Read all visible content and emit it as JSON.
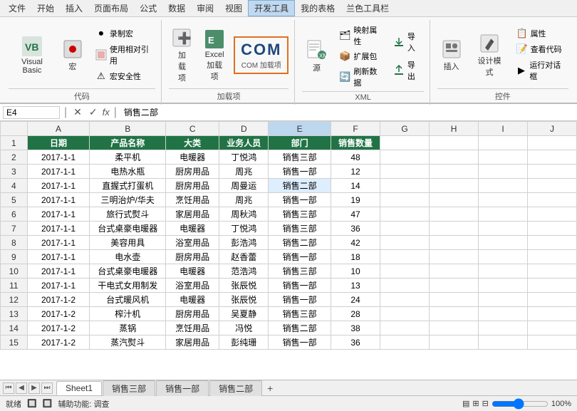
{
  "menu": {
    "items": [
      "文件",
      "开始",
      "插入",
      "页面布局",
      "公式",
      "数据",
      "审阅",
      "视图",
      "开发工具",
      "我的表格",
      "兰色工具栏"
    ],
    "active": "开发工具"
  },
  "ribbon": {
    "groups": [
      {
        "label": "代码",
        "buttons": [
          {
            "id": "visual-basic",
            "icon": "📋",
            "label": "Visual Basic"
          },
          {
            "id": "macro",
            "icon": "⏺",
            "label": "宏"
          }
        ],
        "small_buttons": [
          {
            "id": "record-macro",
            "icon": "⏺",
            "label": "录制宏"
          },
          {
            "id": "use-relative-ref",
            "icon": "📎",
            "label": "使用相对引用"
          },
          {
            "id": "macro-security",
            "icon": "⚠",
            "label": "宏安全性"
          }
        ]
      },
      {
        "label": "加载项",
        "buttons": [
          {
            "id": "add-item",
            "icon": "➕",
            "label": "加载项"
          },
          {
            "id": "excel-addon",
            "icon": "📊",
            "label": "Excel 加载项"
          },
          {
            "id": "com-addon",
            "icon": "COM",
            "label": "COM 加载项"
          }
        ]
      },
      {
        "label": "XML",
        "buttons": [
          {
            "id": "source",
            "icon": "📄",
            "label": "源"
          }
        ],
        "small_buttons": [
          {
            "id": "map-prop",
            "icon": "🗂",
            "label": "映射属性"
          },
          {
            "id": "expand-pack",
            "icon": "📦",
            "label": "扩展包"
          },
          {
            "id": "refresh-data",
            "icon": "🔄",
            "label": "刷新数据"
          },
          {
            "id": "import",
            "icon": "📥",
            "label": "导入"
          },
          {
            "id": "export",
            "icon": "📤",
            "label": "导出"
          }
        ]
      },
      {
        "label": "控件",
        "buttons": [
          {
            "id": "insert-ctrl",
            "icon": "🔲",
            "label": "插入"
          },
          {
            "id": "design-mode",
            "icon": "✏",
            "label": "设计模式"
          }
        ],
        "small_buttons": [
          {
            "id": "properties",
            "icon": "📋",
            "label": "属性"
          },
          {
            "id": "view-code",
            "icon": "📝",
            "label": "查看代码"
          },
          {
            "id": "run-dialog",
            "icon": "▶",
            "label": "运行对话框"
          }
        ]
      }
    ]
  },
  "formula_bar": {
    "name_box": "E4",
    "formula_content": "销售二部",
    "fx": "fx"
  },
  "columns": [
    "A",
    "B",
    "C",
    "D",
    "E",
    "F",
    "G",
    "H",
    "I",
    "J"
  ],
  "headers": [
    "日期",
    "产品名称",
    "大类",
    "业务人员",
    "部门",
    "销售数量"
  ],
  "rows": [
    {
      "num": 2,
      "a": "2017-1-1",
      "b": "柔平机",
      "c": "电暖器",
      "d": "丁悦鸿",
      "e": "销售三部",
      "f": "48"
    },
    {
      "num": 3,
      "a": "2017-1-1",
      "b": "电热水瓶",
      "c": "厨房用品",
      "d": "周兆",
      "e": "销售一部",
      "f": "12"
    },
    {
      "num": 4,
      "a": "2017-1-1",
      "b": "直握式打蛋机",
      "c": "厨房用品",
      "d": "周曼运",
      "e": "销售二部",
      "f": "14",
      "selected": true
    },
    {
      "num": 5,
      "a": "2017-1-1",
      "b": "三明治炉/华夫",
      "c": "烹饪用品",
      "d": "周兆",
      "e": "销售一部",
      "f": "19"
    },
    {
      "num": 6,
      "a": "2017-1-1",
      "b": "旅行式熨斗",
      "c": "家居用品",
      "d": "周秋鸿",
      "e": "销售三部",
      "f": "47"
    },
    {
      "num": 7,
      "a": "2017-1-1",
      "b": "台式桌豪电暖器",
      "c": "电暖器",
      "d": "丁悦鸿",
      "e": "销售三部",
      "f": "36"
    },
    {
      "num": 8,
      "a": "2017-1-1",
      "b": "美容用具",
      "c": "浴室用品",
      "d": "彭浩鸿",
      "e": "销售二部",
      "f": "42"
    },
    {
      "num": 9,
      "a": "2017-1-1",
      "b": "电水壶",
      "c": "厨房用品",
      "d": "赵香蕾",
      "e": "销售一部",
      "f": "18"
    },
    {
      "num": 10,
      "a": "2017-1-1",
      "b": "台式桌豪电暖器",
      "c": "电暖器",
      "d": "范浩鸿",
      "e": "销售三部",
      "f": "10"
    },
    {
      "num": 11,
      "a": "2017-1-1",
      "b": "干电式女用制发",
      "c": "浴室用品",
      "d": "张辰悦",
      "e": "销售一部",
      "f": "13"
    },
    {
      "num": 12,
      "a": "2017-1-2",
      "b": "台式暖风机",
      "c": "电暖器",
      "d": "张辰悦",
      "e": "销售一部",
      "f": "24"
    },
    {
      "num": 13,
      "a": "2017-1-2",
      "b": "榨汁机",
      "c": "厨房用品",
      "d": "吴夏静",
      "e": "销售三部",
      "f": "28"
    },
    {
      "num": 14,
      "a": "2017-1-2",
      "b": "蒸锅",
      "c": "烹饪用品",
      "d": "冯悦",
      "e": "销售二部",
      "f": "38"
    },
    {
      "num": 15,
      "a": "2017-1-2",
      "b": "蒸汽熨斗",
      "c": "家居用品",
      "d": "彭纯珊",
      "e": "销售一部",
      "f": "36"
    }
  ],
  "sheet_tabs": [
    "Sheet1",
    "销售三部",
    "销售一部",
    "销售二部"
  ],
  "active_sheet": "Sheet1",
  "status": {
    "ready": "就绪",
    "accessibility": "辅助功能: 调查"
  }
}
